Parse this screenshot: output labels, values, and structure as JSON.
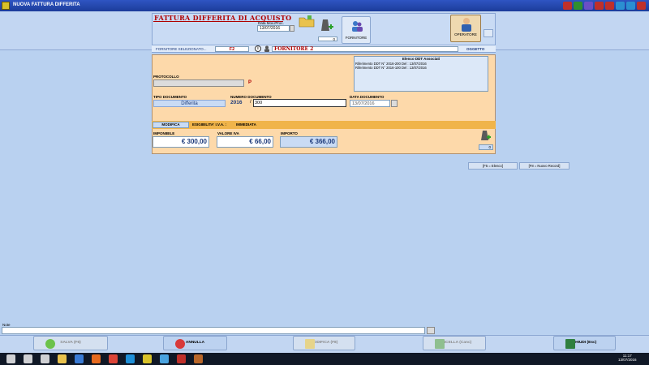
{
  "window": {
    "title": "NUOVA FATTURA DIFFERITA"
  },
  "title_bar_buttons": [
    {
      "icon": "calendar-icon",
      "color": "#c0302a"
    },
    {
      "icon": "info-icon",
      "color": "#2f8f2f"
    },
    {
      "icon": "settings-icon",
      "color": "#6b4fc6"
    },
    {
      "icon": "calendar2-icon",
      "color": "#c0302a"
    },
    {
      "icon": "document-icon",
      "color": "#c0302a"
    },
    {
      "icon": "download-icon",
      "color": "#2b8fd1"
    },
    {
      "icon": "help-icon",
      "color": "#2b8fd1"
    },
    {
      "icon": "close-icon",
      "color": "#c0302a"
    }
  ],
  "header": {
    "title": "FATTURA DIFFERITA DI ACQUISTO",
    "date_mov_label": "Data Mov./Proc.",
    "date_mov_value": "13/07/2016",
    "counter": "0",
    "fornitore_button": "FORNITORE",
    "operatore_button": "OPERATORE"
  },
  "fornitore": {
    "label": "FORNITORE SELEZIONATO...",
    "code": "F2",
    "name": "FORNITORE 2",
    "oggetto_label": "OGGETTO"
  },
  "ddt": {
    "title": "Elenco DDT Associati",
    "items": [
      "Riferimento DDT N° 2016-200   Del : 13/07/2016",
      "Riferimento DDT N° 2016-100   Del : 13/07/2016"
    ]
  },
  "protocollo": {
    "label": "PROTOCOLLO",
    "value": "",
    "suffix": "P"
  },
  "tipo_documento": {
    "label": "TIPO DOCUMENTO",
    "value": "Differita"
  },
  "numero_documento": {
    "label": "NUMERO DOCUMENTO",
    "year": "2016",
    "separator": "/",
    "value": "300"
  },
  "data_documento": {
    "label": "DATA DOCUMENTO",
    "value": "13/07/2016"
  },
  "iva": {
    "modifica_button": "MODIFICA",
    "esigibilita_label": "ESIGIBILITA' I.V.A. :",
    "esigibilita_value": "IMMEDIATA"
  },
  "totals": {
    "imponibile_label": "IMPONIBILE",
    "imponibile": "€ 300,00",
    "iva_label": "VALORE IVA",
    "iva": "€ 66,00",
    "importo_label": "IMPORTO",
    "importo": "€ 366,00",
    "counter": "0"
  },
  "fkeys": {
    "f5": "[F5 = Elenco]",
    "f8": "[F8 = Nuovo Record]"
  },
  "note": {
    "label": "Note",
    "value": ""
  },
  "bottom_buttons": {
    "salva": "SALVA (F6)",
    "annulla": "ANNULLA",
    "modifica": "MODIFICA (F8)",
    "cancella": "CANCELLA (Canc)",
    "chiudi": "CHIUDI (Esc)"
  },
  "taskbar": {
    "apps": [
      "start-icon",
      "search-icon",
      "task-view-icon",
      "explorer-icon",
      "store-icon",
      "firefox-icon",
      "chrome-icon",
      "edge-icon",
      "app-icon",
      "app2-icon",
      "app3-icon",
      "app4-icon"
    ],
    "time": "11:17",
    "date": "13/07/2016"
  }
}
